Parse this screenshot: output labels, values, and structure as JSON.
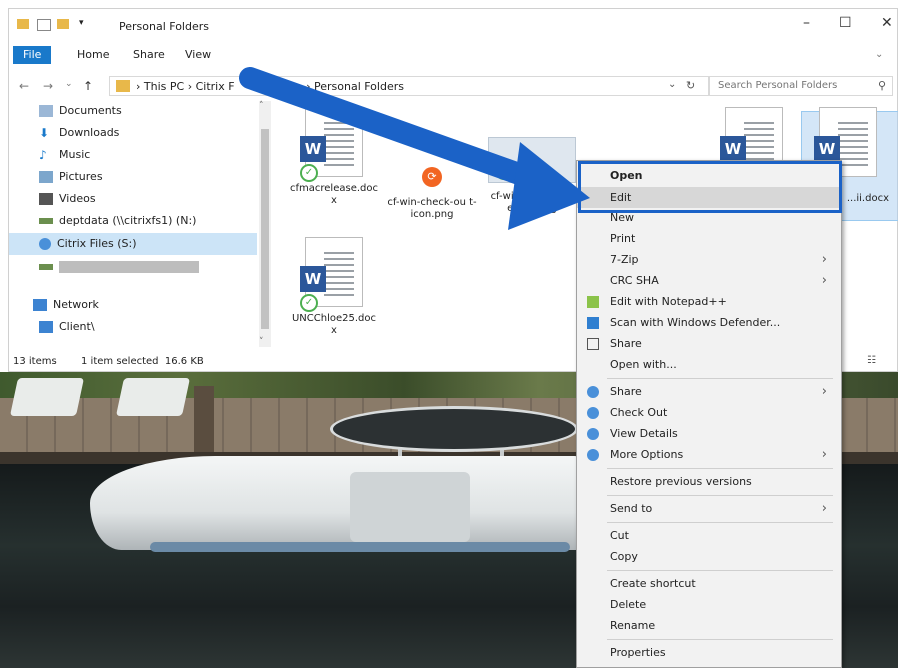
{
  "window": {
    "title": "Personal Folders",
    "controls": {
      "minimize": "–",
      "maximize": "☐",
      "close": "✕"
    }
  },
  "ribbon": {
    "tabs": [
      "File",
      "Home",
      "Share",
      "View"
    ]
  },
  "address": {
    "crumbs": [
      "This PC",
      "Citrix F",
      "Personal Folders"
    ],
    "search_placeholder": "Search Personal Folders"
  },
  "nav": {
    "items": [
      {
        "label": "Documents",
        "icon": "documents-icon"
      },
      {
        "label": "Downloads",
        "icon": "downloads-icon"
      },
      {
        "label": "Music",
        "icon": "music-icon"
      },
      {
        "label": "Pictures",
        "icon": "pictures-icon"
      },
      {
        "label": "Videos",
        "icon": "videos-icon"
      },
      {
        "label": "deptdata (\\\\citrixfs1) (N:)",
        "icon": "network-drive-icon"
      },
      {
        "label": "Citrix Files (S:)",
        "icon": "citrix-drive-icon",
        "selected": true
      },
      {
        "label": "",
        "icon": "network-drive-icon",
        "redacted": true
      },
      {
        "label": "Network",
        "icon": "network-icon"
      },
      {
        "label": "Client\\",
        "icon": "computer-icon"
      }
    ]
  },
  "files": [
    {
      "name": "cfmacrelease.doc x",
      "type": "word"
    },
    {
      "name": "cf-win-check-ou t-icon.png",
      "type": "png"
    },
    {
      "name": "cf-win-link-shar -email.png",
      "type": "png"
    },
    {
      "name": "",
      "type": "word"
    },
    {
      "name": "...ii.docx",
      "type": "word",
      "selected": true
    },
    {
      "name": "UNCChloe25.doc x",
      "type": "word"
    }
  ],
  "status": {
    "items_count": "13 items",
    "selection": "1 item selected  16.6 KB"
  },
  "context_menu": {
    "items": [
      {
        "label": "Open",
        "bold": true
      },
      {
        "label": "Edit",
        "highlighted": true
      },
      {
        "label": "New"
      },
      {
        "label": "Print"
      },
      {
        "label": "7-Zip",
        "submenu": true
      },
      {
        "label": "CRC SHA",
        "submenu": true
      },
      {
        "label": "Edit with Notepad++",
        "icon": "notepad-icon"
      },
      {
        "label": "Scan with Windows Defender...",
        "icon": "defender-icon"
      },
      {
        "label": "Share",
        "icon": "share-icon"
      },
      {
        "label": "Open with..."
      },
      {
        "label": "Share",
        "icon": "citrix-icon",
        "submenu": true
      },
      {
        "label": "Check Out",
        "icon": "citrix-icon"
      },
      {
        "label": "View Details",
        "icon": "citrix-icon"
      },
      {
        "label": "More Options",
        "icon": "citrix-icon",
        "submenu": true
      },
      {
        "label": "Restore previous versions"
      },
      {
        "label": "Send to",
        "submenu": true
      },
      {
        "label": "Cut"
      },
      {
        "label": "Copy"
      },
      {
        "label": "Create shortcut"
      },
      {
        "label": "Delete"
      },
      {
        "label": "Rename"
      },
      {
        "label": "Properties"
      }
    ]
  },
  "colors": {
    "accent": "#1979ca",
    "annotation": "#1b62c7",
    "selection": "#cce4f7"
  }
}
